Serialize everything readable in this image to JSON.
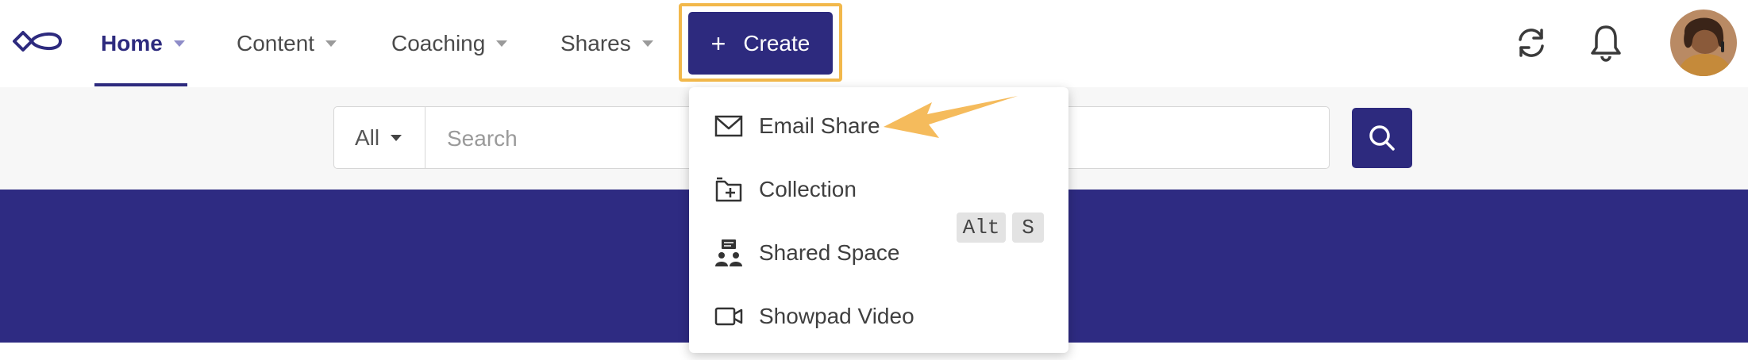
{
  "header": {
    "nav": [
      {
        "label": "Home",
        "active": true
      },
      {
        "label": "Content",
        "active": false
      },
      {
        "label": "Coaching",
        "active": false
      },
      {
        "label": "Shares",
        "active": false
      }
    ],
    "create_button": {
      "label": "Create",
      "icon": "plus-icon",
      "highlight_color": "#f2b84b"
    },
    "icons": [
      "sync-icon",
      "bell-icon"
    ],
    "avatar": "user-avatar"
  },
  "search": {
    "scope": "All",
    "placeholder": "Search",
    "value": ""
  },
  "create_menu": {
    "items": [
      {
        "label": "Email Share",
        "icon": "envelope-icon"
      },
      {
        "label": "Collection",
        "icon": "collection-add-icon"
      },
      {
        "label": "Shared Space",
        "icon": "shared-space-icon"
      },
      {
        "label": "Showpad Video",
        "icon": "video-camera-icon",
        "shortcut": [
          "Alt",
          "S"
        ]
      }
    ]
  },
  "colors": {
    "brand": "#2d2a7e",
    "hero": "#2e2b82",
    "highlight": "#f2b84b",
    "annotation_arrow": "#f5bb5c"
  }
}
